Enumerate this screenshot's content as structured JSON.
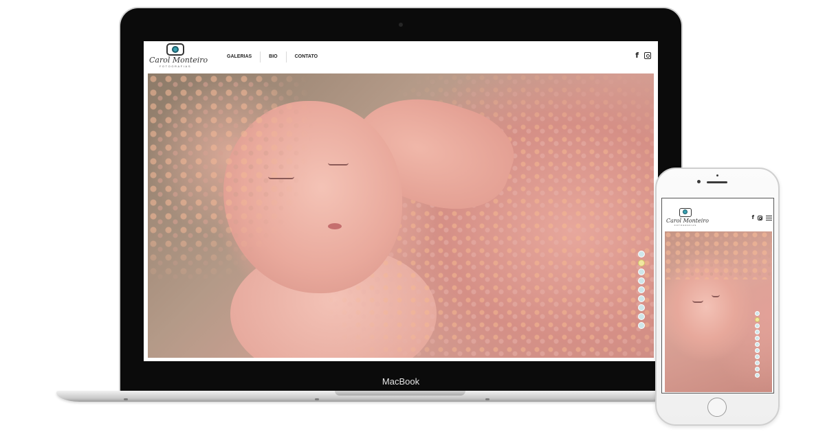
{
  "site": {
    "brand_name": "Carol Monteiro",
    "brand_tagline": "FOTOGRAFIAS",
    "nav": [
      {
        "label": "GALERIAS"
      },
      {
        "label": "BIO"
      },
      {
        "label": "CONTATO"
      }
    ],
    "social": {
      "facebook_glyph": "f",
      "icons": [
        "facebook-icon",
        "instagram-icon"
      ]
    },
    "slider": {
      "total": 9,
      "active_index": 1
    }
  },
  "mobile": {
    "icons": [
      "facebook-icon",
      "instagram-icon",
      "menu-icon"
    ],
    "slider": {
      "total": 11,
      "active_index": 1
    }
  },
  "device_labels": {
    "laptop": "MacBook"
  },
  "colors": {
    "laptop_bezel": "#0b0b0b",
    "accent_lens": "#3aa0b0",
    "dot_active": "#f1e8a0",
    "dot_inactive": "#cfe7ea"
  }
}
